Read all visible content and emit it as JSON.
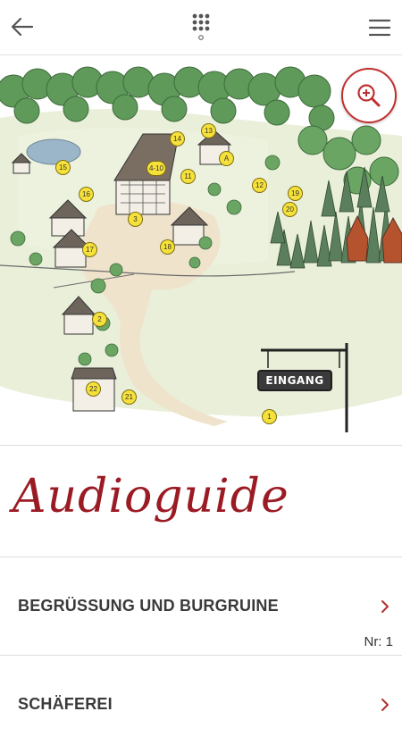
{
  "header": {
    "back_icon": "arrow-left-icon",
    "keypad_icon": "number-keypad-icon",
    "menu_icon": "hamburger-menu-icon"
  },
  "map": {
    "zoom_icon": "zoom-in-icon",
    "sign_label": "EINGANG",
    "markers": [
      "14",
      "13",
      "4-10",
      "A",
      "15",
      "11",
      "16",
      "12",
      "19",
      "20",
      "3",
      "17",
      "18",
      "2",
      "22",
      "21",
      "1"
    ]
  },
  "title": "Audioguide",
  "items": [
    {
      "label": "BEGRÜSSUNG UND BURGRUINE",
      "nr": "Nr: 1"
    },
    {
      "label": "SCHÄFEREI"
    }
  ],
  "colors": {
    "accent": "#9b1b24",
    "marker": "#f6e13a"
  }
}
